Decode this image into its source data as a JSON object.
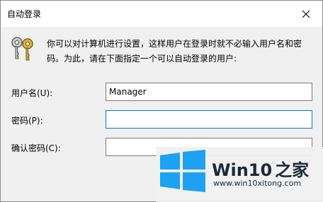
{
  "window": {
    "title": "自动登录"
  },
  "description": "你可以对计算机进行设置，这样用户在登录时就不必输入用户名和密码。为此，请在下面指定一个可以自动登录的用户:",
  "form": {
    "username_label": "用户名(U):",
    "username_value": "Manager",
    "password_label": "密码(P):",
    "password_value": "",
    "confirm_label": "确认密码(C):",
    "confirm_value": ""
  },
  "watermark": {
    "brand_prefix": "Win10",
    "brand_suffix": "之家",
    "url": "www.win10xitong.com",
    "colors": {
      "logo": "#1da1f2",
      "brand_accent": "#1a2a3a"
    }
  },
  "icons": {
    "close": "close-icon",
    "keys": "keys-icon",
    "logo": "windows-logo-icon"
  }
}
